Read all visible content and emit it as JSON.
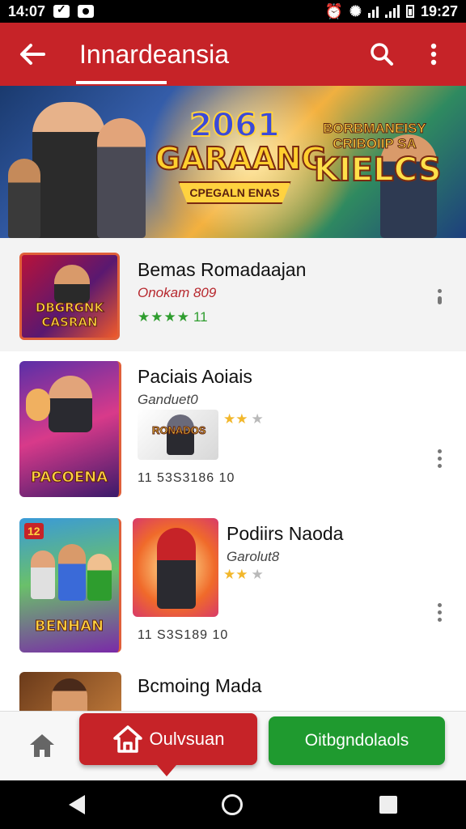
{
  "status_bar": {
    "left_time": "14:07",
    "right_time": "19:27"
  },
  "app_bar": {
    "title": "Innardeansia"
  },
  "banner": {
    "logo_year": "2061",
    "logo_main": "GARAANG",
    "logo_sub": "CPEGALN ENAS",
    "right_top": "BORBMANEISY CRIBOIIP SA",
    "right_big": "KIELCS"
  },
  "items": [
    {
      "title": "Bemas Romadaajan",
      "subtitle": "Onokam 809",
      "rating_count": "11",
      "thumb_text": "DBGRGNK CASRAN",
      "stars": "★★★★"
    },
    {
      "title": "Paciais Aoiais",
      "subtitle": "Ganduet0",
      "thumb_text": "PACOENA",
      "mini_text": "RONADOS",
      "meta": "11 53S3186 10"
    },
    {
      "title": "Podiirs Naoda",
      "subtitle": "Garolut8",
      "thumb_text": "BENHAN",
      "thumb_badge": "12",
      "meta": "11 S3S189 10"
    },
    {
      "title": "Bcmoing Mada"
    }
  ],
  "bottom_bar": {
    "primary_label": "Oulvsuan",
    "secondary_label": "Oitbgndolaols"
  },
  "colors": {
    "brand_red": "#c62328",
    "green": "#1f9a2f"
  }
}
